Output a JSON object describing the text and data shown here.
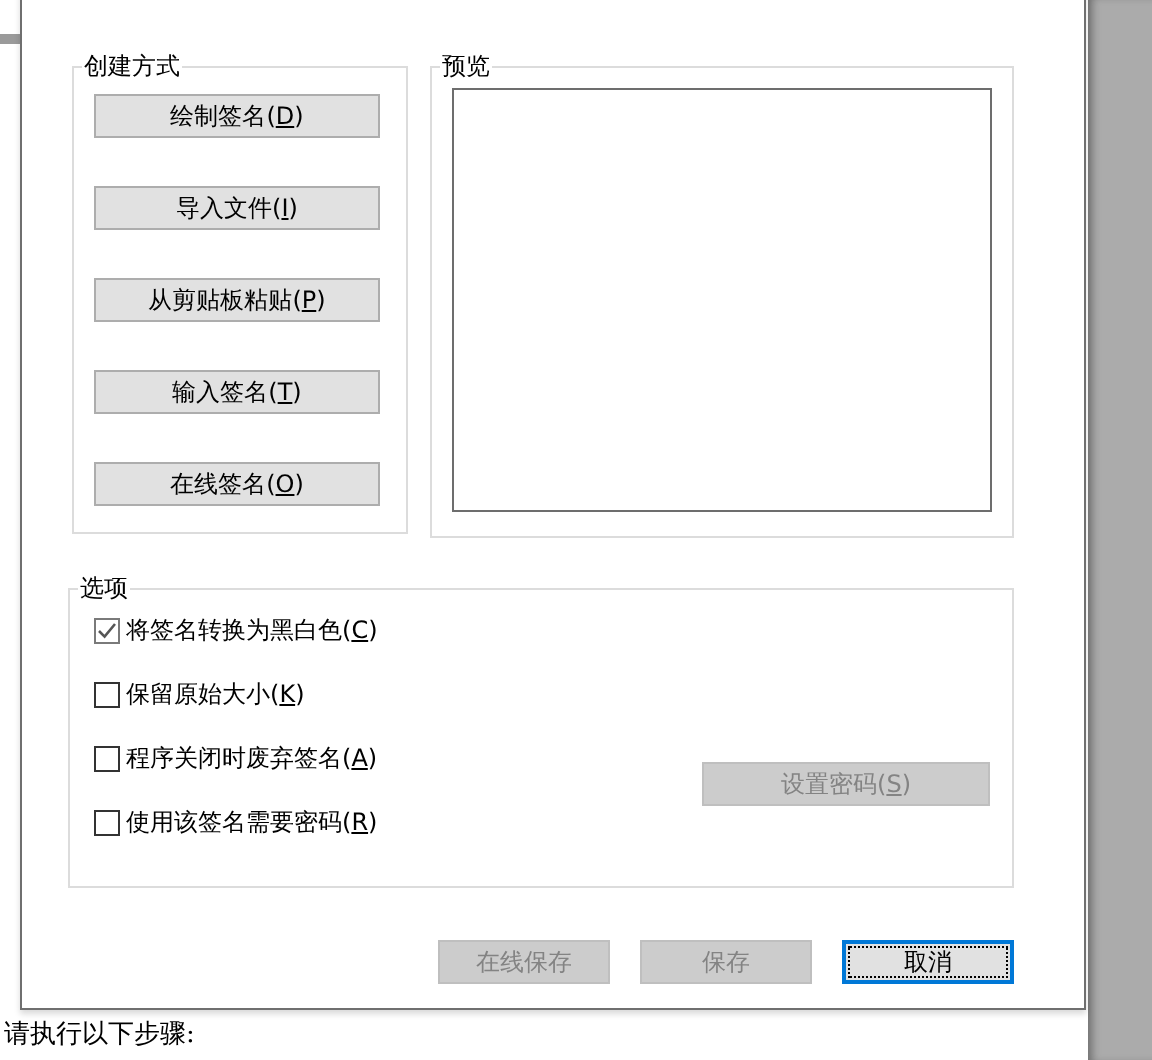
{
  "document": {
    "footer_line": "请执行以下步骤:"
  },
  "dialog": {
    "create_group": {
      "title": "创建方式",
      "buttons": [
        {
          "label": "绘制签名(D)"
        },
        {
          "label": "导入文件(I)"
        },
        {
          "label": "从剪贴板粘贴(P)"
        },
        {
          "label": "输入签名(T)"
        },
        {
          "label": "在线签名(O)"
        }
      ]
    },
    "preview_group": {
      "title": "预览"
    },
    "options_group": {
      "title": "选项",
      "options": [
        {
          "label": "将签名转换为黑白色(C)",
          "checked": true
        },
        {
          "label": "保留原始大小(K)",
          "checked": false
        },
        {
          "label": "程序关闭时废弃签名(A)",
          "checked": false
        },
        {
          "label": "使用该签名需要密码(R)",
          "checked": false
        }
      ],
      "password_button": {
        "label": "设置密码(S)",
        "disabled": true
      }
    },
    "buttons": [
      {
        "label": "在线保存",
        "disabled": true,
        "focused": false
      },
      {
        "label": "保存",
        "disabled": true,
        "focused": false
      },
      {
        "label": "取消",
        "disabled": false,
        "focused": true
      }
    ]
  }
}
